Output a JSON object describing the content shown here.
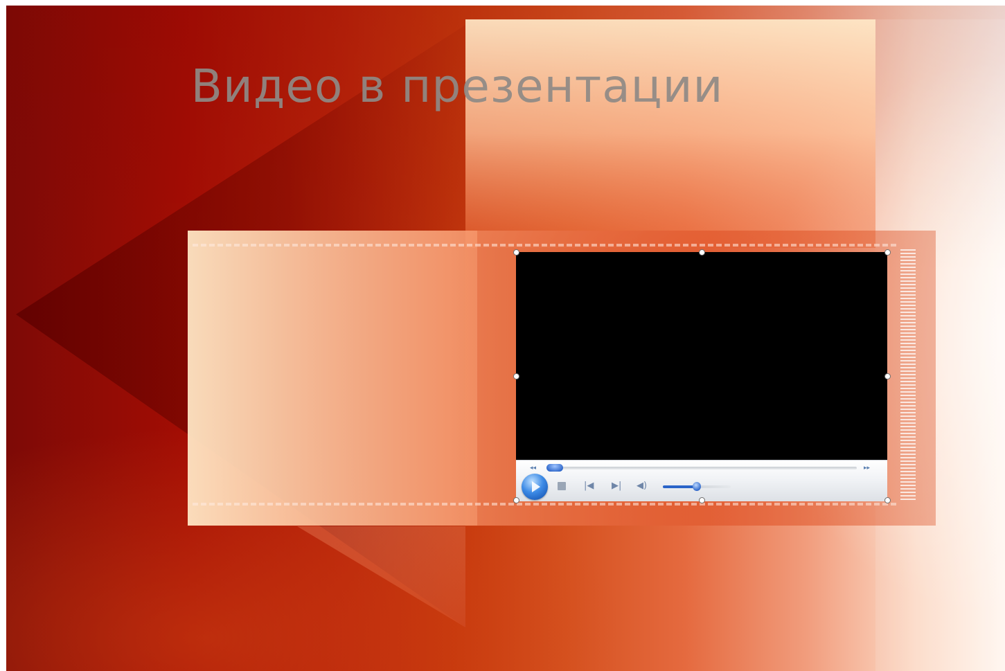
{
  "slide": {
    "title": "Видео в презентации",
    "background_colors": [
      "#7d0a06",
      "#a30d04",
      "#c6380d",
      "#e56a3f",
      "#fcd9c5"
    ],
    "title_color": "#8f8a86"
  },
  "media_player": {
    "video_color": "#000000",
    "seek_position": 0.0,
    "volume_level": 0.5,
    "controls": {
      "play": "play-icon",
      "stop": "stop-icon",
      "previous": "previous-icon",
      "next": "next-icon",
      "mute": "volume-icon"
    },
    "accent_color": "#2a64c8",
    "seek_back_symbol": "◂◂",
    "seek_forward_symbol": "▸▸",
    "prev_symbol": "|◀",
    "next_symbol": "▶|",
    "volume_symbol": "◀)"
  },
  "selection": {
    "handle_count": 8
  }
}
